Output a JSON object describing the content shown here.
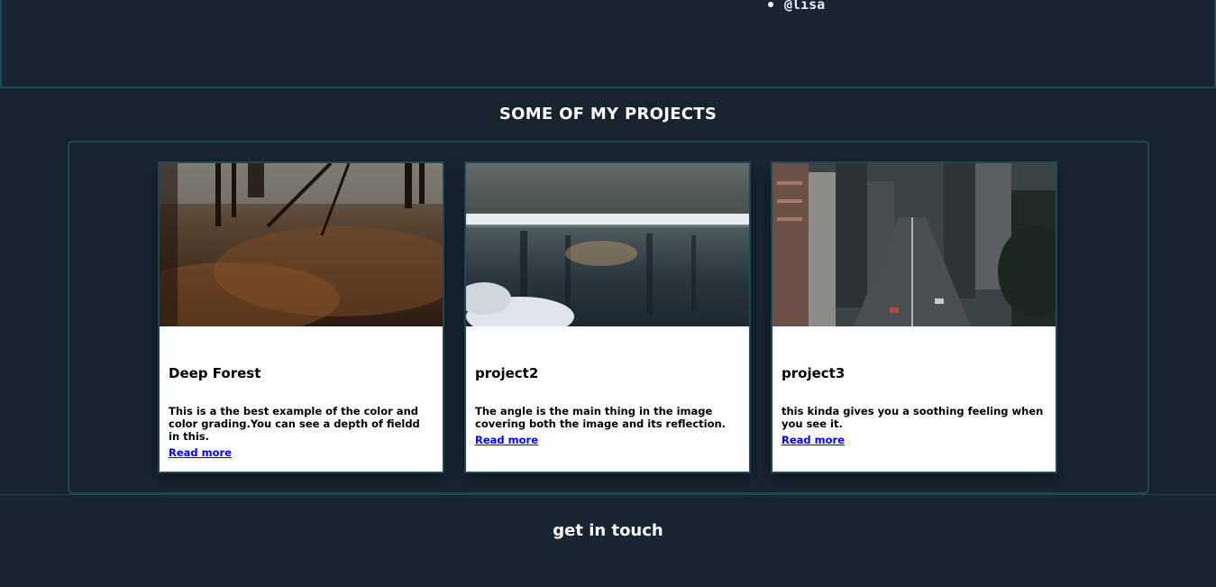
{
  "profile": {
    "handles": [
      "@lisa"
    ]
  },
  "projects_section": {
    "title": "SOME OF MY PROJECTS",
    "cards": [
      {
        "image_icon": "forest-photo",
        "title": "Deep Forest",
        "description": "This is a the best example of the color and color grading.You can see a depth of fieldd in this.",
        "link_label": "Read more"
      },
      {
        "image_icon": "lake-reflection-photo",
        "title": "project2",
        "description": "The angle is the main thing in the image covering both the image and its reflection.",
        "link_label": "Read more"
      },
      {
        "image_icon": "city-street-photo",
        "title": "project3",
        "description": "this kinda gives you a soothing feeling when you see it.",
        "link_label": "Read more"
      }
    ]
  },
  "contact_section": {
    "title": "get in touch"
  },
  "colors": {
    "background": "#19232f",
    "border_accent": "#1d4a52",
    "link": "#0000ee"
  }
}
